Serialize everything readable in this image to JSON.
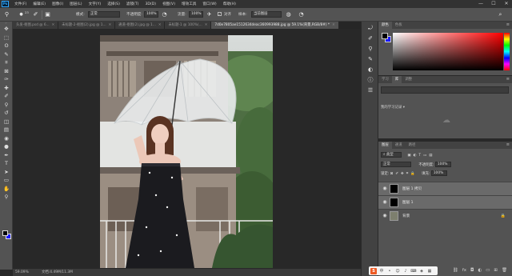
{
  "menu": [
    "文件(F)",
    "编辑(E)",
    "图像(I)",
    "图层(L)",
    "文字(Y)",
    "选择(S)",
    "滤镜(T)",
    "3D(D)",
    "视图(V)",
    "增效工具",
    "窗口(W)",
    "帮助(H)"
  ],
  "window_controls": {
    "minimize": "—",
    "maximize": "☐",
    "close": "✕"
  },
  "options": {
    "mode_label": "模式:",
    "mode_value": "正常",
    "opacity_label": "不透明度:",
    "opacity_value": "100%",
    "flow_label": "流量:",
    "flow_value": "100%",
    "align_label": "对齐",
    "sample_label": "样本:",
    "sample_value": "当前图层",
    "brush_size": "23"
  },
  "tabs": [
    {
      "label": "头发-抠图.psd @ 6...",
      "active": false
    },
    {
      "label": "未标题-2-抠图(2).jpg @ 1...",
      "active": false
    },
    {
      "label": "通道-抠图(2).jpg @ 1...",
      "active": false
    },
    {
      "label": "未标题-1 @ 100%(...",
      "active": false
    },
    {
      "label": "7d0e7805ae1512634deac360993988.jpg @ 59.1%(背景,RGB/8#) *",
      "active": true
    }
  ],
  "tools": [
    "move-icon",
    "marquee-icon",
    "lasso-icon",
    "quick-select-icon",
    "crop-icon",
    "frame-icon",
    "eyedropper-icon",
    "healing-icon",
    "brush-icon",
    "clone-stamp-icon",
    "history-brush-icon",
    "eraser-icon",
    "gradient-icon",
    "blur-icon",
    "dodge-icon",
    "pen-icon",
    "type-icon",
    "path-select-icon",
    "rectangle-icon",
    "hand-icon",
    "zoom-icon"
  ],
  "tool_glyphs": [
    "✥",
    "⬚",
    "ʘ",
    "✎",
    "⌗",
    "⊠",
    "✑",
    "✚",
    "✐",
    "⚲",
    "↺",
    "◫",
    "▤",
    "◉",
    "●",
    "✒",
    "T",
    "➤",
    "▭",
    "✋",
    "⚲"
  ],
  "status": {
    "zoom": "59.09%",
    "doc": "文档:4.49M/11.3M"
  },
  "colors": {
    "foreground": "#000000",
    "background": "#1a1aff",
    "accent": "#31a8ff"
  },
  "color_panel": {
    "tabs": [
      "颜色",
      "色板"
    ]
  },
  "lib_panel": {
    "tabs": [
      "学习",
      "库",
      "调整"
    ],
    "dropdown": "我的学习记录"
  },
  "layers_panel": {
    "tabs": [
      "图层",
      "通道",
      "路径"
    ],
    "filter_label": "类型",
    "blend_mode": "正常",
    "opacity_label": "不透明度:",
    "opacity_value": "100%",
    "lock_label": "锁定:",
    "fill_label": "填充:",
    "fill_value": "100%",
    "layers": [
      {
        "name": "图层 1 拷贝",
        "selected": true
      },
      {
        "name": "图层 1",
        "selected": true
      },
      {
        "name": "背景",
        "selected": false
      }
    ],
    "footer_icons": [
      "link-icon",
      "fx-icon",
      "mask-icon",
      "adjustment-icon",
      "group-icon",
      "new-layer-icon",
      "delete-icon"
    ]
  },
  "ime": {
    "logo": "S"
  }
}
